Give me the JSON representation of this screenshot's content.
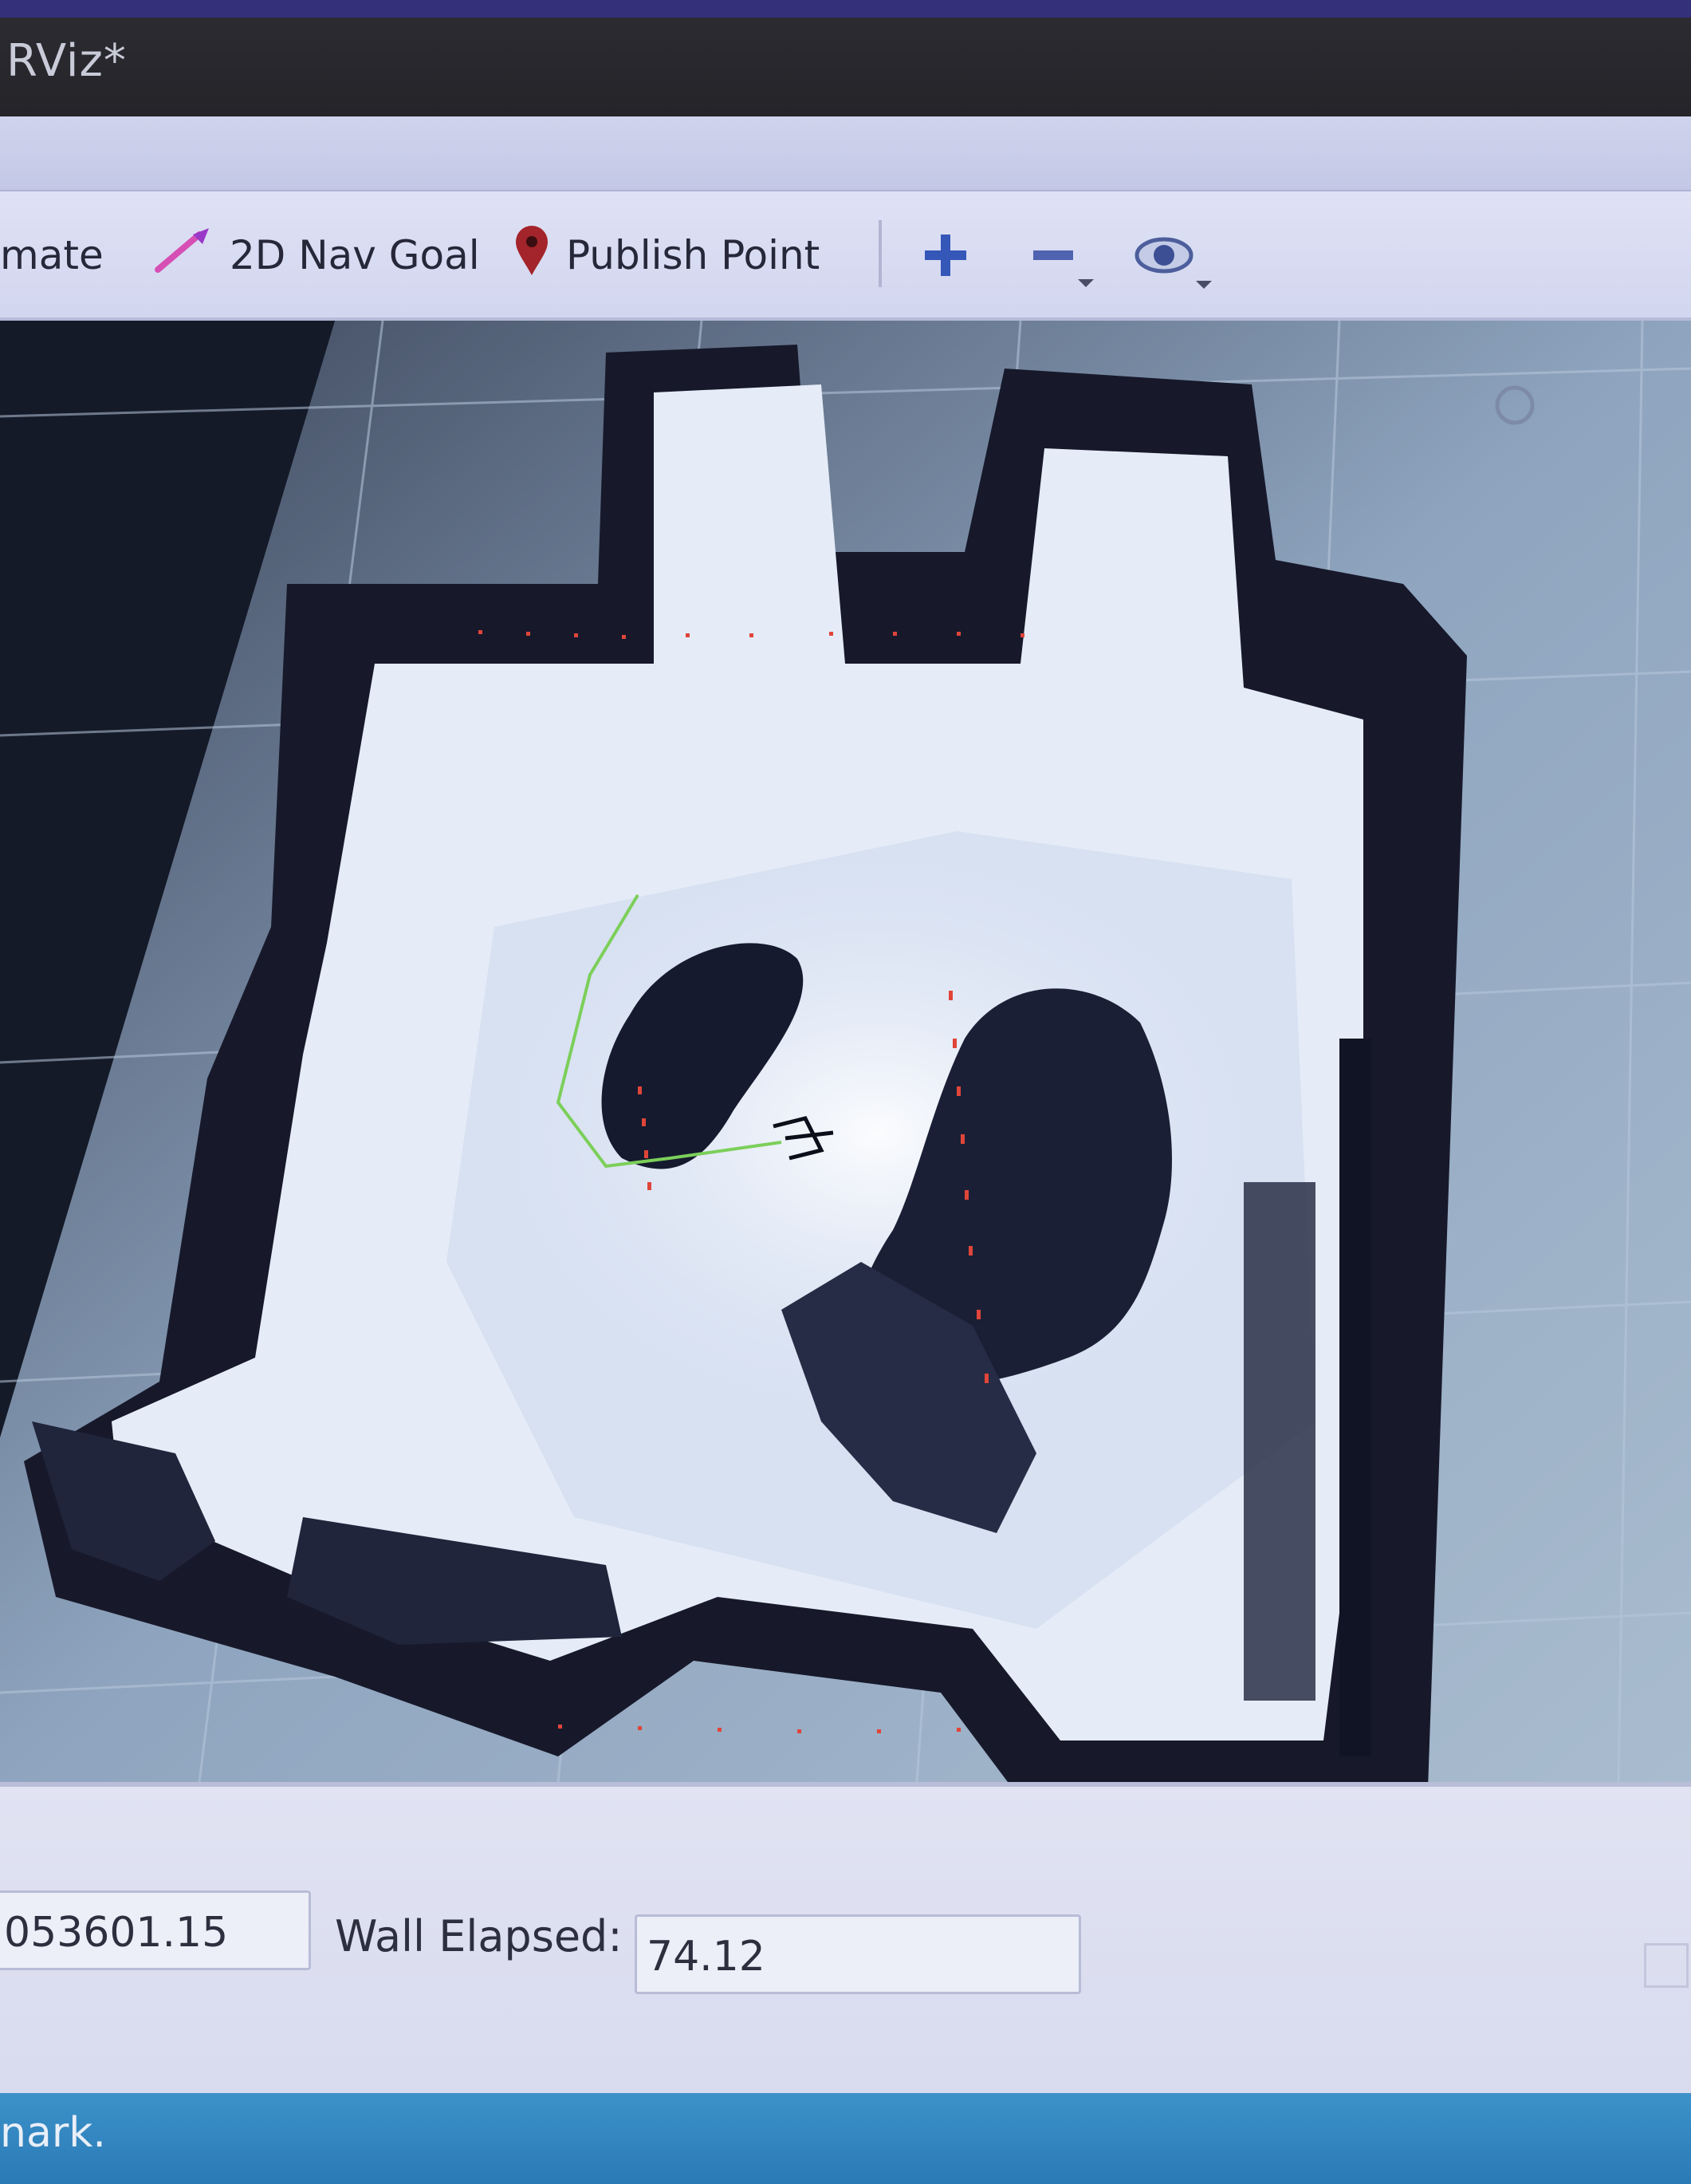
{
  "window": {
    "title": "RViz*"
  },
  "toolbar": {
    "tools": [
      {
        "label": "mate",
        "icon": "pose-estimate-arrow-icon"
      },
      {
        "label": "2D Nav Goal",
        "icon": "nav-goal-arrow-icon"
      },
      {
        "label": "Publish Point",
        "icon": "map-pin-icon"
      }
    ],
    "view_buttons": [
      "plus-icon",
      "minus-icon",
      "eye-icon"
    ]
  },
  "viewport": {
    "description_icon": "move-camera-icon",
    "map_colors": {
      "unknown": "#9eb2c8",
      "free": "#e8eef8",
      "occupied": "#15182a",
      "path": "#7ccf5a",
      "laser": "#e0453a"
    }
  },
  "time_panel": {
    "wall_time_value": "053601.15",
    "wall_elapsed_label": "Wall Elapsed:",
    "wall_elapsed_value": "74.12"
  },
  "status": {
    "text": "nark."
  }
}
